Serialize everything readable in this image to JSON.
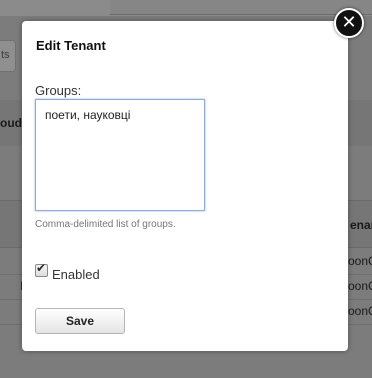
{
  "background": {
    "tab_stub": "ts",
    "header_fragment": "oud'",
    "column_header_fragment": "enant",
    "row_cells": [
      "oonC",
      "oonC",
      "oonC"
    ],
    "left_mark": "I"
  },
  "modal": {
    "title": "Edit Tenant",
    "groups_label": "Groups:",
    "groups_value": "поети, науковці",
    "help_text": "Comma-delimited list of groups.",
    "enabled_label": "Enabled",
    "enabled_checked": true,
    "save_label": "Save",
    "close_icon": "close-icon"
  },
  "colors": {
    "overlay": "#7f7f7f",
    "modal_bg": "#ffffff",
    "focus_border": "#8fa9d8"
  }
}
